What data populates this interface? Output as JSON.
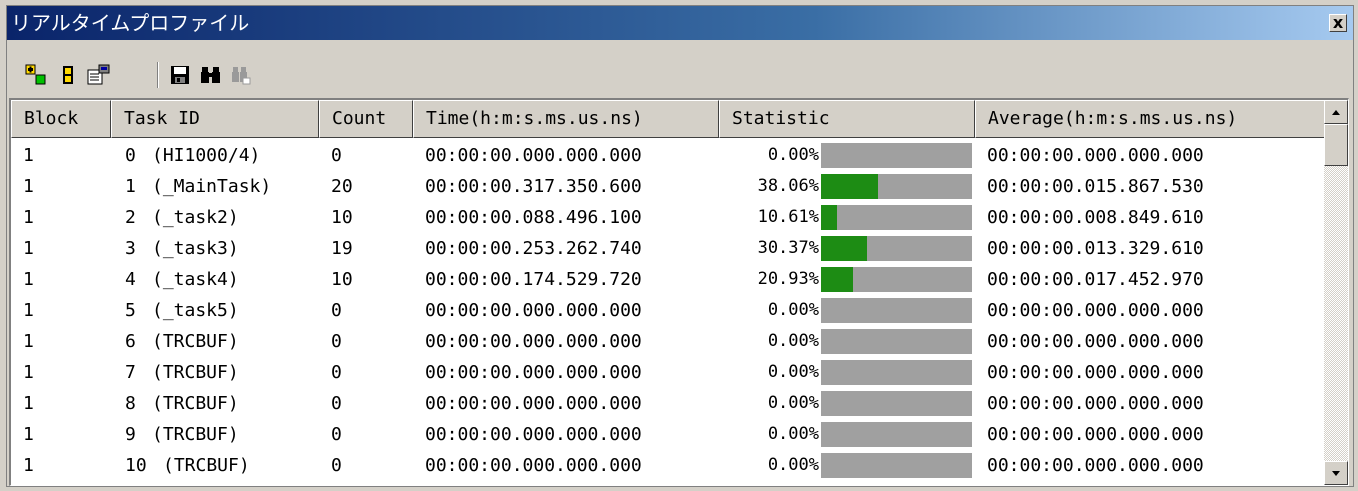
{
  "window": {
    "title": "リアルタイムプロファイル",
    "close_glyph": "x"
  },
  "toolbar": {
    "buttons": [
      {
        "icon": "add-icon"
      },
      {
        "icon": "bars-icon"
      },
      {
        "icon": "properties-icon"
      },
      {
        "icon": "save-icon"
      },
      {
        "icon": "find-icon"
      },
      {
        "icon": "find-next-icon"
      }
    ]
  },
  "table": {
    "columns": [
      "Block",
      "Task ID",
      "Count",
      "Time(h:m:s.ms.us.ns)",
      "Statistic",
      "Average(h:m:s.ms.us.ns)"
    ],
    "rows": [
      {
        "block": "1",
        "num": "0",
        "task": "(HI1000/4)",
        "count": "0",
        "time": "00:00:00.000.000.000",
        "stat": "0.00%",
        "frac": 0.0,
        "avg": "00:00:00.000.000.000"
      },
      {
        "block": "1",
        "num": "1",
        "task": "(_MainTask)",
        "count": "20",
        "time": "00:00:00.317.350.600",
        "stat": "38.06%",
        "frac": 0.3806,
        "avg": "00:00:00.015.867.530"
      },
      {
        "block": "1",
        "num": "2",
        "task": "(_task2)",
        "count": "10",
        "time": "00:00:00.088.496.100",
        "stat": "10.61%",
        "frac": 0.1061,
        "avg": "00:00:00.008.849.610"
      },
      {
        "block": "1",
        "num": "3",
        "task": "(_task3)",
        "count": "19",
        "time": "00:00:00.253.262.740",
        "stat": "30.37%",
        "frac": 0.3037,
        "avg": "00:00:00.013.329.610"
      },
      {
        "block": "1",
        "num": "4",
        "task": "(_task4)",
        "count": "10",
        "time": "00:00:00.174.529.720",
        "stat": "20.93%",
        "frac": 0.2093,
        "avg": "00:00:00.017.452.970"
      },
      {
        "block": "1",
        "num": "5",
        "task": "(_task5)",
        "count": "0",
        "time": "00:00:00.000.000.000",
        "stat": "0.00%",
        "frac": 0.0,
        "avg": "00:00:00.000.000.000"
      },
      {
        "block": "1",
        "num": "6",
        "task": "(TRCBUF)",
        "count": "0",
        "time": "00:00:00.000.000.000",
        "stat": "0.00%",
        "frac": 0.0,
        "avg": "00:00:00.000.000.000"
      },
      {
        "block": "1",
        "num": "7",
        "task": "(TRCBUF)",
        "count": "0",
        "time": "00:00:00.000.000.000",
        "stat": "0.00%",
        "frac": 0.0,
        "avg": "00:00:00.000.000.000"
      },
      {
        "block": "1",
        "num": "8",
        "task": "(TRCBUF)",
        "count": "0",
        "time": "00:00:00.000.000.000",
        "stat": "0.00%",
        "frac": 0.0,
        "avg": "00:00:00.000.000.000"
      },
      {
        "block": "1",
        "num": "9",
        "task": "(TRCBUF)",
        "count": "0",
        "time": "00:00:00.000.000.000",
        "stat": "0.00%",
        "frac": 0.0,
        "avg": "00:00:00.000.000.000"
      },
      {
        "block": "1",
        "num": "10",
        "task": "(TRCBUF)",
        "count": "0",
        "time": "00:00:00.000.000.000",
        "stat": "0.00%",
        "frac": 0.0,
        "avg": "00:00:00.000.000.000"
      }
    ]
  },
  "colors": {
    "bar_fill": "#1d8c14",
    "bar_track": "#a0a0a0",
    "title_start": "#0a246a"
  }
}
